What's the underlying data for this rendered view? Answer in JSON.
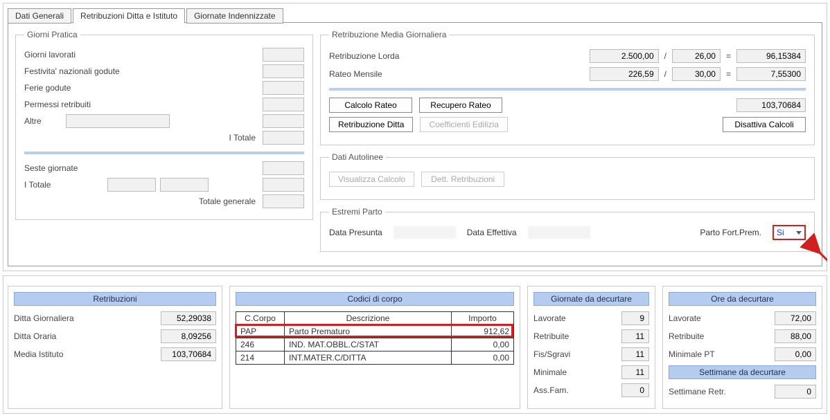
{
  "tabs": {
    "t1": "Dati Generali",
    "t2": "Retribuzioni Ditta e Istituto",
    "t3": "Giornate Indennizzate"
  },
  "giorni_pratica": {
    "legend": "Giorni Pratica",
    "lavorati": "Giorni lavorati",
    "festivita": "Festivita' nazionali godute",
    "ferie": "Ferie godute",
    "permessi": "Permessi retribuiti",
    "altre": "Altre",
    "itotale": "I Totale",
    "seste": "Seste giornate",
    "itotale2": "I Totale",
    "totale_gen": "Totale generale"
  },
  "rmg": {
    "legend": "Retribuzione Media Giornaliera",
    "lorda": "Retribuzione Lorda",
    "lorda_a": "2.500,00",
    "lorda_b": "26,00",
    "lorda_r": "96,15384",
    "rateo": "Rateo Mensile",
    "rateo_a": "226,59",
    "rateo_b": "30,00",
    "rateo_r": "7,55300",
    "btn_calcolo": "Calcolo Rateo",
    "btn_recupero": "Recupero Rateo",
    "btn_ditta": "Retribuzione Ditta",
    "btn_coeff": "Coefficienti Edilizia",
    "btn_disattiva": "Disattiva Calcoli",
    "totale": "103,70684"
  },
  "autolinee": {
    "legend": "Dati Autolinee",
    "btn_vis": "Visualizza Calcolo",
    "btn_dett": "Dett. Retribuzioni"
  },
  "parto": {
    "legend": "Estremi Parto",
    "presunta": "Data Presunta",
    "effettiva": "Data Effettiva",
    "fort": "Parto Fort.Prem.",
    "select_val": "Si"
  },
  "retribuzioni": {
    "title": "Retribuzioni",
    "ditta_g": "Ditta Giornaliera",
    "ditta_g_v": "52,29038",
    "ditta_o": "Ditta Oraria",
    "ditta_o_v": "8,09256",
    "media": "Media Istituto",
    "media_v": "103,70684"
  },
  "codici": {
    "title": "Codici di corpo",
    "h1": "C.Corpo",
    "h2": "Descrizione",
    "h3": "Importo",
    "rows": [
      {
        "c": "PAP",
        "d": "Parto Prematuro",
        "v": "912,62"
      },
      {
        "c": "246",
        "d": "IND. MAT.OBBL.C/STAT",
        "v": "0,00"
      },
      {
        "c": "214",
        "d": "INT.MATER.C/DITTA",
        "v": "0,00"
      }
    ]
  },
  "giornate": {
    "title": "Giornate da decurtare",
    "lavorate": "Lavorate",
    "lavorate_v": "9",
    "retrib": "Retribuite",
    "retrib_v": "11",
    "fis": "Fis/Sgravi",
    "fis_v": "11",
    "min": "Minimale",
    "min_v": "11",
    "ass": "Ass.Fam.",
    "ass_v": "0"
  },
  "ore": {
    "title": "Ore da decurtare",
    "lavorate": "Lavorate",
    "lavorate_v": "72,00",
    "retrib": "Retribuite",
    "retrib_v": "88,00",
    "minpt": "Minimale PT",
    "minpt_v": "0,00",
    "sett_title": "Settimane da decurtare",
    "sett": "Settimane Retr.",
    "sett_v": "0"
  }
}
